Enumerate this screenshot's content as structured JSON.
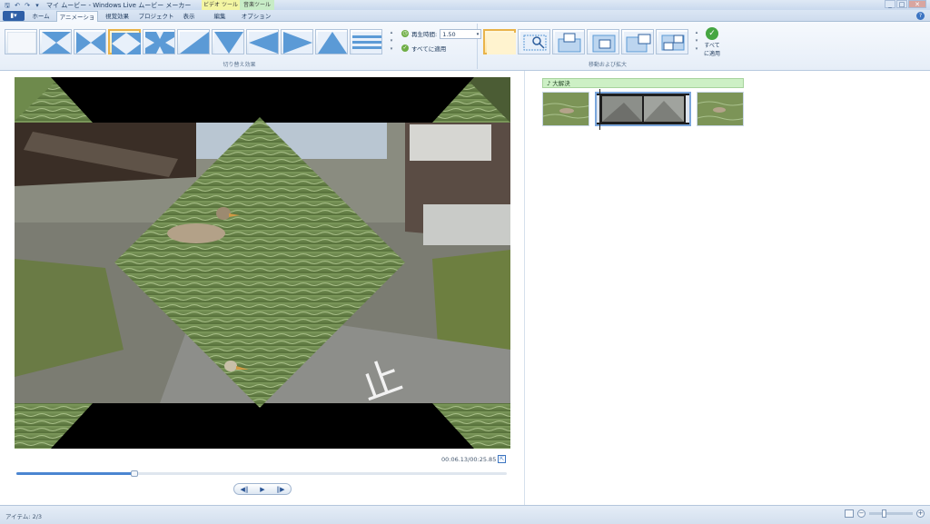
{
  "window": {
    "title": "マイ ムービー - Windows Live ムービー メーカー",
    "context_tabs": {
      "video_tools": "ビデオ ツール",
      "music_tools": "音楽ツール"
    },
    "controls": [
      "_",
      "□",
      "✕"
    ]
  },
  "qat": {
    "icons": [
      "save-icon",
      "undo-icon",
      "redo-icon",
      "customize-icon"
    ],
    "glyphs": [
      "🖫",
      "↶",
      "↷",
      "▾"
    ]
  },
  "tabs": [
    {
      "label": "ホーム",
      "active": false
    },
    {
      "label": "アニメーション",
      "active": true
    },
    {
      "label": "視覚効果",
      "active": false
    },
    {
      "label": "プロジェクト",
      "active": false
    },
    {
      "label": "表示",
      "active": false
    },
    {
      "label": "編集",
      "active": false
    },
    {
      "label": "オプション",
      "active": false
    }
  ],
  "file_button": "▮▾",
  "ribbon": {
    "transitions": {
      "group_label": "切り替え効果",
      "thumb_icons": [
        "none",
        "bowtie-vertical",
        "bowtie-horizontal",
        "diamond",
        "cross",
        "diagonal-up",
        "chevron-down",
        "arrow-left",
        "arrow-right",
        "triangle-up",
        "lines-horizontal"
      ],
      "selected_index": 3,
      "duration_label": "再生時間:",
      "duration_value": "1.50",
      "apply_all_label": "すべてに適用"
    },
    "pan_zoom": {
      "group_label": "移動および拡大",
      "thumb_count": 6,
      "selected_index": 0,
      "apply_all_label_line1": "すべて",
      "apply_all_label_line2": "に適用"
    }
  },
  "preview": {
    "time_readout": "00:06.13/00:25.85",
    "seek_progress": 0.24,
    "transport": {
      "prev": "◀‖",
      "play": "▶",
      "next": "‖▶"
    }
  },
  "storyboard": {
    "music_label": "♪ 大解決",
    "clips": [
      "clip-1",
      "clip-2-selected",
      "clip-3"
    ]
  },
  "status": {
    "items_text": "アイテム: 2/3",
    "zoom_level": 0.35
  },
  "colors": {
    "ribbon_bg": "#eef3fa",
    "selected_accent": "#e9b34a",
    "music_bar": "#cdf0c5",
    "seek_fill": "#4b86d1"
  }
}
